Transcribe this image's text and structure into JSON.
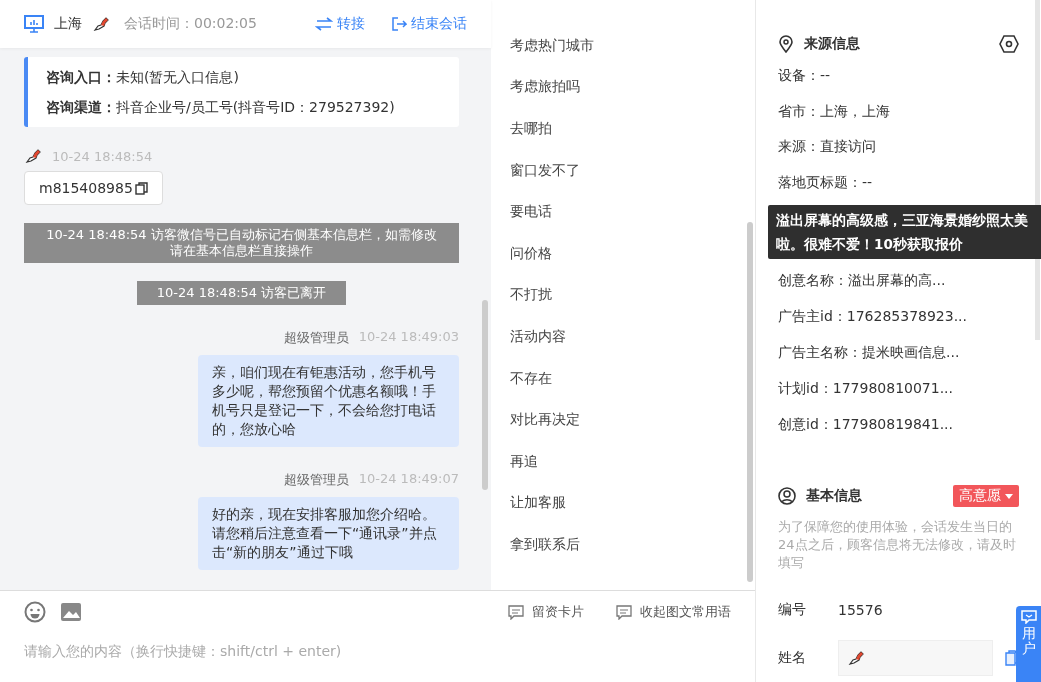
{
  "header": {
    "location": "上海",
    "session_time": "会话时间：00:02:05",
    "actions": [
      {
        "kind": "transfer",
        "label": "转接"
      },
      {
        "kind": "end",
        "label": "结束会话"
      }
    ]
  },
  "consult_info": [
    {
      "label": "咨询入口：",
      "value": "未知(暂无入口信息)"
    },
    {
      "label": "咨询渠道：",
      "value": "抖音企业号/员工号(抖音号ID：279527392)"
    }
  ],
  "messages": [
    {
      "kind": "visitor",
      "time": "10-24 18:48:54",
      "text": "m815408985"
    },
    {
      "kind": "system",
      "text": "10-24 18:48:54 访客微信号已自动标记右侧基本信息栏，如需修改请在基本信息栏直接操作"
    },
    {
      "kind": "system",
      "text": "10-24 18:48:54 访客已离开"
    },
    {
      "kind": "agent",
      "sender": "超级管理员",
      "time": "10-24 18:49:03",
      "text": "亲，咱们现在有钜惠活动，您手机号多少呢，帮您预留个优惠名额哦！手机号只是登记一下，不会给您打电话的，您放心哈"
    },
    {
      "kind": "agent",
      "sender": "超级管理员",
      "time": "10-24 18:49:07",
      "text": "好的亲，现在安排客服加您介绍哈。请您稍后注意查看一下“通讯录”并点击“新的朋友”通过下哦"
    }
  ],
  "quick_phrases": [
    "考虑热门城市",
    "考虑旅拍吗",
    "去哪拍",
    "窗口发不了",
    "要电话",
    "问价格",
    "不打扰",
    "活动内容",
    "不存在",
    "对比再决定",
    "再追",
    "让加客服",
    "拿到联系后"
  ],
  "toolbar": {
    "tools": [
      "留资卡片",
      "收起图文常用语"
    ],
    "input_placeholder": "请输入您的内容（换行快捷键：shift/ctrl + enter)"
  },
  "source_info": {
    "title": "来源信息",
    "fields": [
      {
        "kind": "text",
        "text": "设备：--"
      },
      {
        "kind": "text",
        "text": "省市：上海，上海"
      },
      {
        "kind": "text",
        "text": "来源：直接访问"
      },
      {
        "kind": "text",
        "text": "落地页标题：--"
      },
      {
        "kind": "tooltip",
        "text": "溢出屏幕的高级感，三亚海景婚纱照太美啦。很难不爱！10秒获取报价"
      },
      {
        "kind": "text",
        "text": "创意名称：溢出屏幕的高..."
      },
      {
        "kind": "text",
        "text": "广告主id：176285378923..."
      },
      {
        "kind": "text",
        "text": "广告主名称：提米映画信息..."
      },
      {
        "kind": "text",
        "text": "计划id：177980810071..."
      },
      {
        "kind": "text",
        "text": "创意id：177980819841..."
      }
    ]
  },
  "basic_info": {
    "title": "基本信息",
    "intent_tag": "高意愿",
    "notice": "为了保障您的使用体验，会话发生当日的24点之后，顾客信息将无法修改，请及时填写",
    "fields": [
      {
        "kind": "text",
        "label": "编号",
        "value": "15576"
      },
      {
        "kind": "avatar_input",
        "label": "姓名"
      }
    ]
  },
  "feedback_tab": "用户"
}
